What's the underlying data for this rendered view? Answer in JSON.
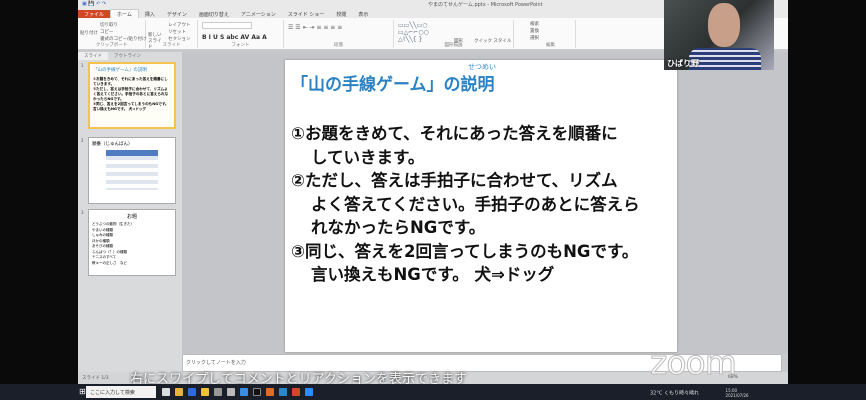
{
  "window": {
    "title": "やまのてせんゲーム.pptx - Microsoft PowerPoint"
  },
  "ribbon": {
    "tabs": [
      "ファイル",
      "ホーム",
      "挿入",
      "デザイン",
      "画面切り替え",
      "アニメーション",
      "スライド ショー",
      "校閲",
      "表示"
    ],
    "groups": [
      "クリップボード",
      "スライド",
      "フォント",
      "段落",
      "図形描画",
      "編集"
    ],
    "buttons": [
      "貼り付け",
      "切り取り",
      "コピー",
      "書式のコピー/貼り付け",
      "新しいスライド",
      "レイアウト",
      "リセット",
      "セクション",
      "図形",
      "クイック スタイル",
      "検索",
      "置換",
      "選択"
    ]
  },
  "pane_tabs": [
    "スライド",
    "アウトライン"
  ],
  "thumbnails": [
    {
      "num": "1",
      "title": "「山の手線ゲーム」の説明"
    },
    {
      "num": "2",
      "title": "順番（じゅんばん）"
    },
    {
      "num": "3",
      "title": "お題",
      "items": [
        "どうぶつの動物（生きた）",
        "やまいの種類",
        "しゅみの種類",
        "ほかの種類",
        "あそびの種類",
        "ふんぱつ（？）の種類",
        "テニスのすべて",
        "教キーの正しさ　など"
      ]
    }
  ],
  "slide": {
    "title": "「山の手線ゲーム」の説明",
    "ruby": "せつめい",
    "lines": [
      "①お題をきめて、それにあった答えを順番にしていきます。",
      "②ただし、答えは手拍子に合わせて、リズムよく答えてください。手拍子のあとに答えられなかったらNGです。",
      "③同じ、答えを2回言ってしまうのもNGです。言い換えもNGです。 犬⇒ドッグ"
    ],
    "display": [
      "①お題をきめて、それにあった答えを順番に",
      "していきます。",
      "②ただし、答えは手拍子に合わせて、リズム",
      "よく答えてください。手拍子のあとに答えら",
      "れなかったらNGです。",
      "③同じ、答えを2回言ってしまうのもNGです。",
      "言い換えもNGです。 犬⇒ドッグ"
    ]
  },
  "notes": {
    "placeholder": "クリックしてノートを入力"
  },
  "status": {
    "slide": "スライド 1/3",
    "zoom": "68%"
  },
  "taskbar": {
    "search_placeholder": "ここに入力して検索",
    "weather": "32°C くもり時々晴れ",
    "time": "15:00",
    "date": "2021/07/26"
  },
  "video": {
    "participant_name": "ひばり野"
  },
  "zoom": {
    "watermark": "zoom",
    "overlay_hint": "右にスワイプしてコメントとリアクションを表示できます"
  }
}
